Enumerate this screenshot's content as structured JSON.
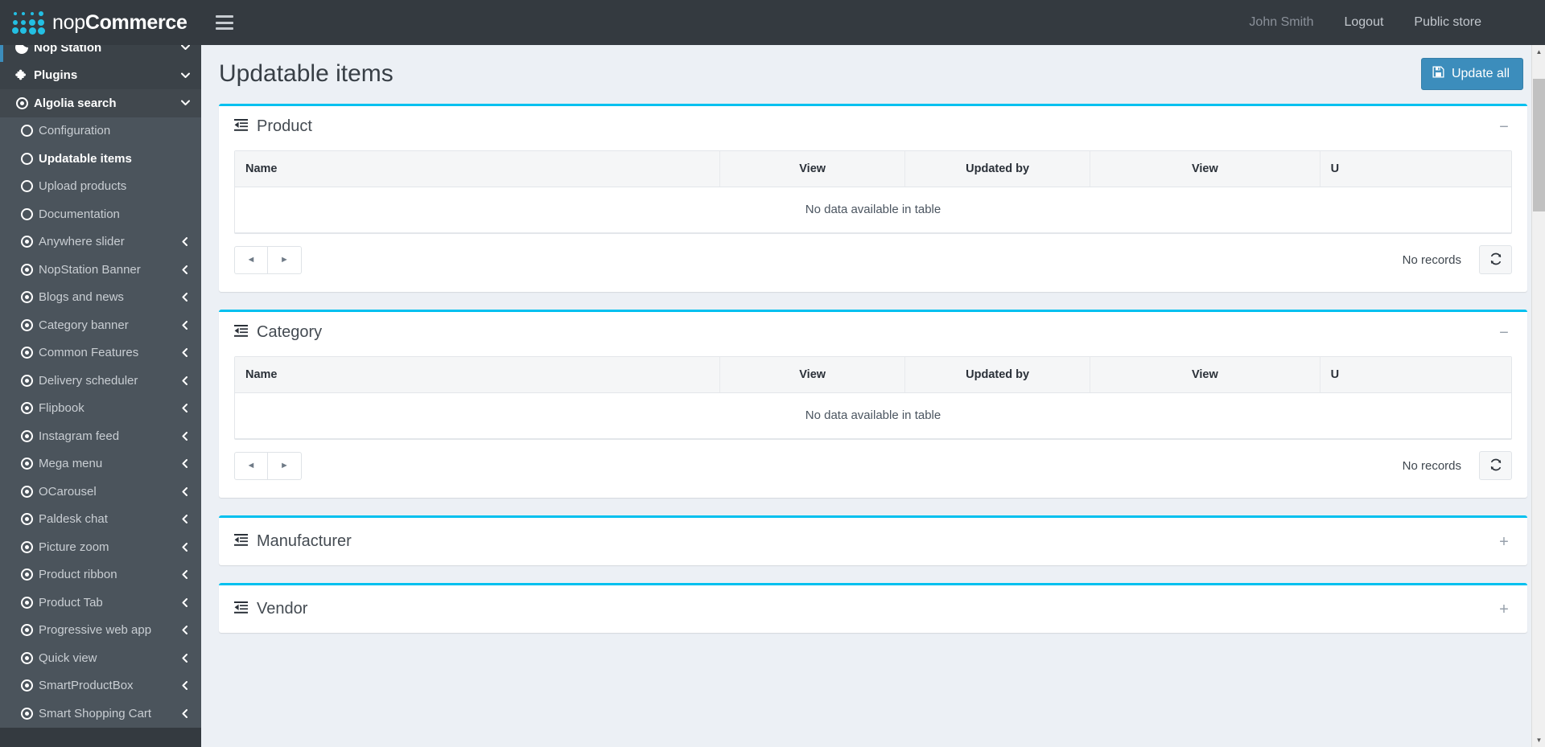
{
  "brand": {
    "name_light": "nop",
    "name_bold": "Commerce"
  },
  "topbar": {
    "username": "John Smith",
    "logout_label": "Logout",
    "public_store_label": "Public store",
    "menu_toggle_label": "Toggle navigation"
  },
  "sidebar": {
    "items": [
      {
        "label": "Nop Station",
        "icon": "pie-chart-icon",
        "level": "lvl1",
        "arrow": "chevron-down",
        "active": true
      },
      {
        "label": "Plugins",
        "icon": "puzzle-piece-icon",
        "level": "lvl1b",
        "arrow": "chevron-down",
        "active": false
      },
      {
        "label": "Algolia search",
        "icon": "dot-circle-icon",
        "level": "open-parent",
        "arrow": "chevron-down",
        "active": false
      },
      {
        "label": "Configuration",
        "icon": "circle-icon",
        "level": "sub",
        "arrow": "",
        "active": false
      },
      {
        "label": "Updatable items",
        "icon": "circle-icon",
        "level": "sub selected",
        "arrow": "",
        "active": true
      },
      {
        "label": "Upload products",
        "icon": "circle-icon",
        "level": "sub",
        "arrow": "",
        "active": false
      },
      {
        "label": "Documentation",
        "icon": "circle-icon",
        "level": "sub",
        "arrow": "",
        "active": false
      },
      {
        "label": "Anywhere slider",
        "icon": "dot-circle-icon",
        "level": "plugin",
        "arrow": "chevron-left",
        "active": false
      },
      {
        "label": "NopStation Banner",
        "icon": "dot-circle-icon",
        "level": "plugin",
        "arrow": "chevron-left",
        "active": false
      },
      {
        "label": "Blogs and news",
        "icon": "dot-circle-icon",
        "level": "plugin",
        "arrow": "chevron-left",
        "active": false
      },
      {
        "label": "Category banner",
        "icon": "dot-circle-icon",
        "level": "plugin",
        "arrow": "chevron-left",
        "active": false
      },
      {
        "label": "Common Features",
        "icon": "dot-circle-icon",
        "level": "plugin",
        "arrow": "chevron-left",
        "active": false
      },
      {
        "label": "Delivery scheduler",
        "icon": "dot-circle-icon",
        "level": "plugin",
        "arrow": "chevron-left",
        "active": false
      },
      {
        "label": "Flipbook",
        "icon": "dot-circle-icon",
        "level": "plugin",
        "arrow": "chevron-left",
        "active": false
      },
      {
        "label": "Instagram feed",
        "icon": "dot-circle-icon",
        "level": "plugin",
        "arrow": "chevron-left",
        "active": false
      },
      {
        "label": "Mega menu",
        "icon": "dot-circle-icon",
        "level": "plugin",
        "arrow": "chevron-left",
        "active": false
      },
      {
        "label": "OCarousel",
        "icon": "dot-circle-icon",
        "level": "plugin",
        "arrow": "chevron-left",
        "active": false
      },
      {
        "label": "Paldesk chat",
        "icon": "dot-circle-icon",
        "level": "plugin",
        "arrow": "chevron-left",
        "active": false
      },
      {
        "label": "Picture zoom",
        "icon": "dot-circle-icon",
        "level": "plugin",
        "arrow": "chevron-left",
        "active": false
      },
      {
        "label": "Product ribbon",
        "icon": "dot-circle-icon",
        "level": "plugin",
        "arrow": "chevron-left",
        "active": false
      },
      {
        "label": "Product Tab",
        "icon": "dot-circle-icon",
        "level": "plugin",
        "arrow": "chevron-left",
        "active": false
      },
      {
        "label": "Progressive web app",
        "icon": "dot-circle-icon",
        "level": "plugin",
        "arrow": "chevron-left",
        "active": false
      },
      {
        "label": "Quick view",
        "icon": "dot-circle-icon",
        "level": "plugin",
        "arrow": "chevron-left",
        "active": false
      },
      {
        "label": "SmartProductBox",
        "icon": "dot-circle-icon",
        "level": "plugin",
        "arrow": "chevron-left",
        "active": false
      },
      {
        "label": "Smart Shopping Cart",
        "icon": "dot-circle-icon",
        "level": "plugin",
        "arrow": "chevron-left",
        "active": false
      }
    ]
  },
  "page": {
    "title": "Updatable items",
    "update_all_label": "Update all"
  },
  "panels": [
    {
      "title": "Product",
      "expanded": true,
      "toggle_glyph": "−",
      "columns": [
        "Name",
        "View",
        "Updated by",
        "View",
        "U"
      ],
      "rows": [],
      "empty_text": "No data available in table",
      "records_text": "No records",
      "prev_glyph": "◄",
      "next_glyph": "►"
    },
    {
      "title": "Category",
      "expanded": true,
      "toggle_glyph": "−",
      "columns": [
        "Name",
        "View",
        "Updated by",
        "View",
        "U"
      ],
      "rows": [],
      "empty_text": "No data available in table",
      "records_text": "No records",
      "prev_glyph": "◄",
      "next_glyph": "►"
    },
    {
      "title": "Manufacturer",
      "expanded": false,
      "toggle_glyph": "+",
      "columns": [],
      "rows": [],
      "empty_text": "",
      "records_text": "",
      "prev_glyph": "",
      "next_glyph": ""
    },
    {
      "title": "Vendor",
      "expanded": false,
      "toggle_glyph": "+",
      "columns": [],
      "rows": [],
      "empty_text": "",
      "records_text": "",
      "prev_glyph": "",
      "next_glyph": ""
    }
  ],
  "colors": {
    "accent": "#00c0ef",
    "primary": "#3c8dbc",
    "sidebar_bg": "#343a40",
    "page_bg": "#ecf0f5"
  }
}
